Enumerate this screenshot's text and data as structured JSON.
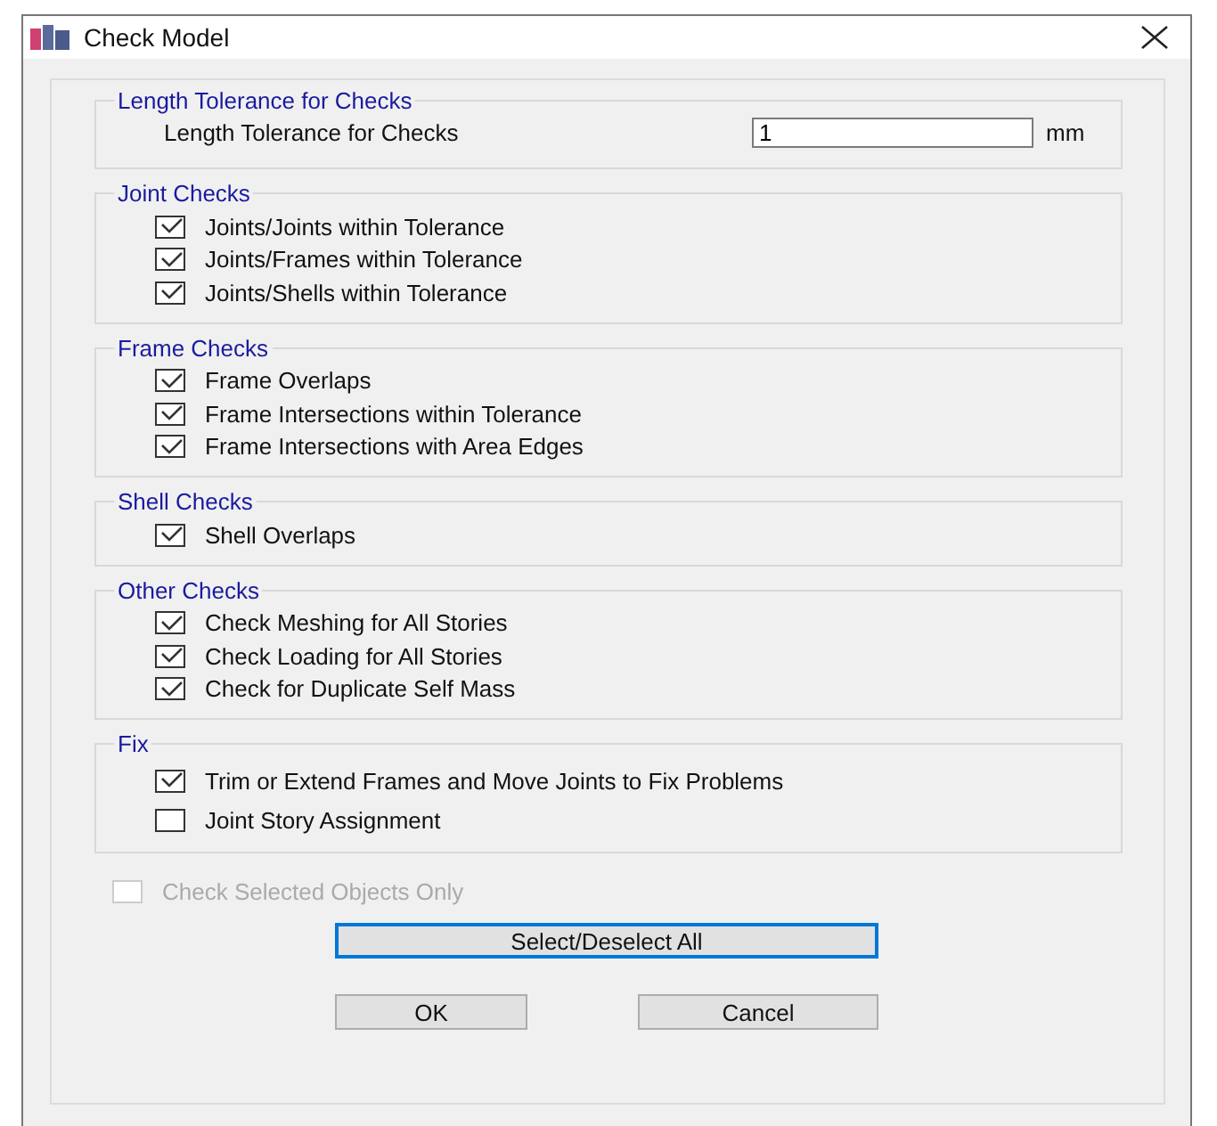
{
  "window": {
    "title": "Check Model"
  },
  "groups": [
    {
      "title": "Length Tolerance for Checks",
      "kind": "field",
      "label": "Length Tolerance for Checks",
      "value": "1",
      "unit": "mm"
    },
    {
      "title": "Joint Checks",
      "kind": "checks",
      "items": [
        {
          "label": "Joints/Joints within Tolerance",
          "checked": true
        },
        {
          "label": "Joints/Frames within Tolerance",
          "checked": true
        },
        {
          "label": "Joints/Shells within Tolerance",
          "checked": true
        }
      ]
    },
    {
      "title": "Frame Checks",
      "kind": "checks",
      "items": [
        {
          "label": "Frame Overlaps",
          "checked": true
        },
        {
          "label": "Frame Intersections within Tolerance",
          "checked": true
        },
        {
          "label": "Frame Intersections with Area Edges",
          "checked": true
        }
      ]
    },
    {
      "title": "Shell Checks",
      "kind": "checks",
      "items": [
        {
          "label": "Shell Overlaps",
          "checked": true
        }
      ]
    },
    {
      "title": "Other Checks",
      "kind": "checks",
      "items": [
        {
          "label": "Check Meshing for All Stories",
          "checked": true
        },
        {
          "label": "Check Loading for All Stories",
          "checked": true
        },
        {
          "label": "Check for Duplicate Self Mass",
          "checked": true
        }
      ]
    },
    {
      "title": "Fix",
      "kind": "checks",
      "items": [
        {
          "label": "Trim or Extend Frames and Move Joints to Fix Problems",
          "checked": true
        },
        {
          "label": "Joint Story Assignment",
          "checked": false
        }
      ]
    }
  ],
  "selected_only": {
    "label": "Check Selected Objects Only",
    "checked": false,
    "disabled": true
  },
  "select_all_button": {
    "label": "Select/Deselect All",
    "focused": true
  },
  "buttons": [
    "OK",
    "Cancel"
  ]
}
